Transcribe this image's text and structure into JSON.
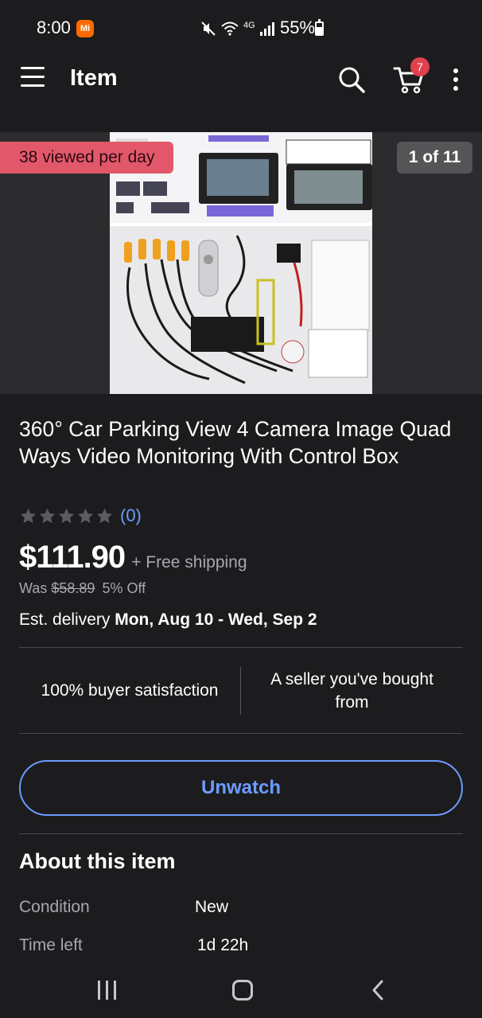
{
  "status_bar": {
    "time": "8:00",
    "notification_app": "Mi",
    "network": "4G",
    "battery": "55%"
  },
  "app_bar": {
    "title": "Item",
    "cart_count": "7"
  },
  "image": {
    "viewed_badge": "38 viewed per day",
    "counter": "1 of 11"
  },
  "product": {
    "title": "360° Car Parking View 4 Camera Image Quad Ways Video Monitoring With Control Box",
    "rating_count": "(0)",
    "stars": 0,
    "price": "$111.90",
    "shipping": "+ Free shipping",
    "was_label": "Was",
    "was_price": "$58.89",
    "discount": "5% Off",
    "delivery_label": "Est. delivery",
    "delivery_dates": "Mon, Aug 10 - Wed, Sep 2"
  },
  "seller": {
    "satisfaction": "100% buyer satisfaction",
    "history": "A seller you've bought from"
  },
  "actions": {
    "unwatch": "Unwatch"
  },
  "about": {
    "title": "About this item",
    "specs": [
      {
        "label": "Condition",
        "value": "New"
      },
      {
        "label": "Time left",
        "value": "1d 22h"
      }
    ]
  },
  "colors": {
    "accent": "#6c9cff",
    "badge_red": "#e2586a",
    "background": "#1c1c1e"
  }
}
